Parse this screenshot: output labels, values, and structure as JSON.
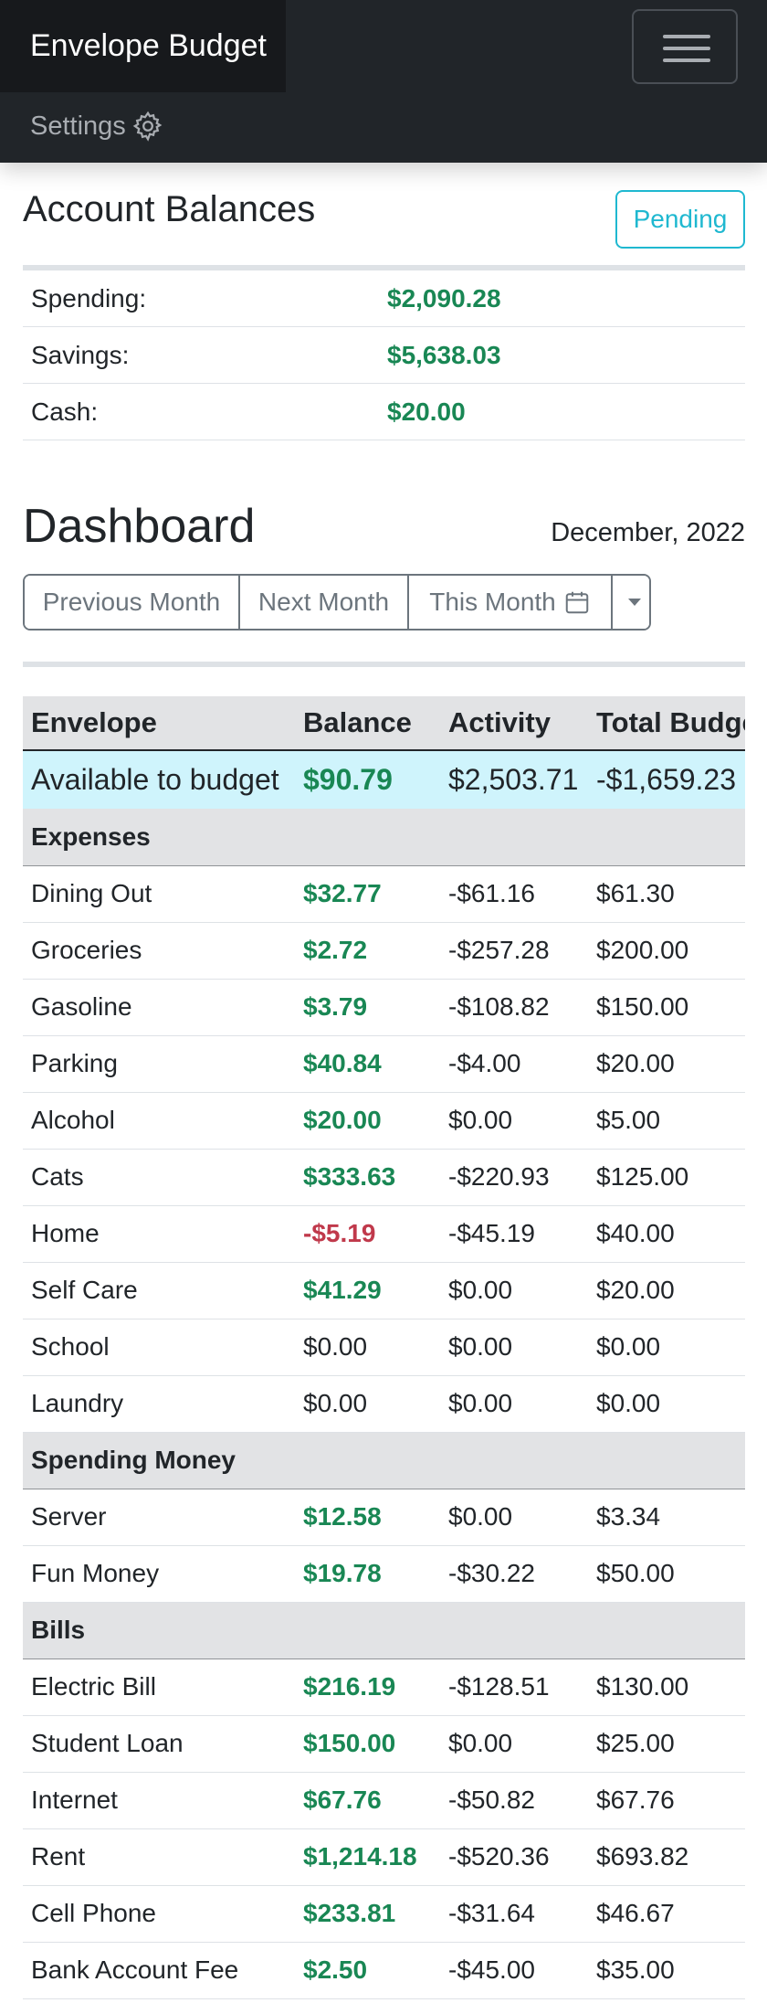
{
  "navbar": {
    "brand": "Envelope Budget",
    "settings_label": "Settings"
  },
  "accounts": {
    "title": "Account Balances",
    "pending_label": "Pending",
    "rows": [
      {
        "label": "Spending:",
        "value": "$2,090.28"
      },
      {
        "label": "Savings:",
        "value": "$5,638.03"
      },
      {
        "label": "Cash:",
        "value": "$20.00"
      }
    ]
  },
  "dashboard": {
    "title": "Dashboard",
    "month": "December, 2022",
    "buttons": {
      "previous": "Previous Month",
      "next": "Next Month",
      "this_month": "This Month"
    }
  },
  "table": {
    "headers": [
      "Envelope",
      "Balance",
      "Activity",
      "Total Budget"
    ],
    "available": {
      "label": "Available to budget",
      "balance": "$90.79",
      "activity": "$2,503.71",
      "total": "-$1,659.23"
    },
    "groups": [
      {
        "name": "Expenses",
        "rows": [
          {
            "envelope": "Dining Out",
            "balance": "$32.77",
            "activity": "-$61.16",
            "total": "$61.30",
            "status": "pos"
          },
          {
            "envelope": "Groceries",
            "balance": "$2.72",
            "activity": "-$257.28",
            "total": "$200.00",
            "status": "pos"
          },
          {
            "envelope": "Gasoline",
            "balance": "$3.79",
            "activity": "-$108.82",
            "total": "$150.00",
            "status": "pos"
          },
          {
            "envelope": "Parking",
            "balance": "$40.84",
            "activity": "-$4.00",
            "total": "$20.00",
            "status": "pos"
          },
          {
            "envelope": "Alcohol",
            "balance": "$20.00",
            "activity": "$0.00",
            "total": "$5.00",
            "status": "pos"
          },
          {
            "envelope": "Cats",
            "balance": "$333.63",
            "activity": "-$220.93",
            "total": "$125.00",
            "status": "pos"
          },
          {
            "envelope": "Home",
            "balance": "-$5.19",
            "activity": "-$45.19",
            "total": "$40.00",
            "status": "neg"
          },
          {
            "envelope": "Self Care",
            "balance": "$41.29",
            "activity": "$0.00",
            "total": "$20.00",
            "status": "pos"
          },
          {
            "envelope": "School",
            "balance": "$0.00",
            "activity": "$0.00",
            "total": "$0.00",
            "status": "zero"
          },
          {
            "envelope": "Laundry",
            "balance": "$0.00",
            "activity": "$0.00",
            "total": "$0.00",
            "status": "zero"
          }
        ]
      },
      {
        "name": "Spending Money",
        "rows": [
          {
            "envelope": "Server",
            "balance": "$12.58",
            "activity": "$0.00",
            "total": "$3.34",
            "status": "pos"
          },
          {
            "envelope": "Fun Money",
            "balance": "$19.78",
            "activity": "-$30.22",
            "total": "$50.00",
            "status": "pos"
          }
        ]
      },
      {
        "name": "Bills",
        "rows": [
          {
            "envelope": "Electric Bill",
            "balance": "$216.19",
            "activity": "-$128.51",
            "total": "$130.00",
            "status": "pos"
          },
          {
            "envelope": "Student Loan",
            "balance": "$150.00",
            "activity": "$0.00",
            "total": "$25.00",
            "status": "pos"
          },
          {
            "envelope": "Internet",
            "balance": "$67.76",
            "activity": "-$50.82",
            "total": "$67.76",
            "status": "pos"
          },
          {
            "envelope": "Rent",
            "balance": "$1,214.18",
            "activity": "-$520.36",
            "total": "$693.82",
            "status": "pos"
          },
          {
            "envelope": "Cell Phone",
            "balance": "$233.81",
            "activity": "-$31.64",
            "total": "$46.67",
            "status": "pos"
          },
          {
            "envelope": "Bank Account Fee",
            "balance": "$2.50",
            "activity": "-$45.00",
            "total": "$35.00",
            "status": "pos"
          }
        ]
      }
    ]
  }
}
